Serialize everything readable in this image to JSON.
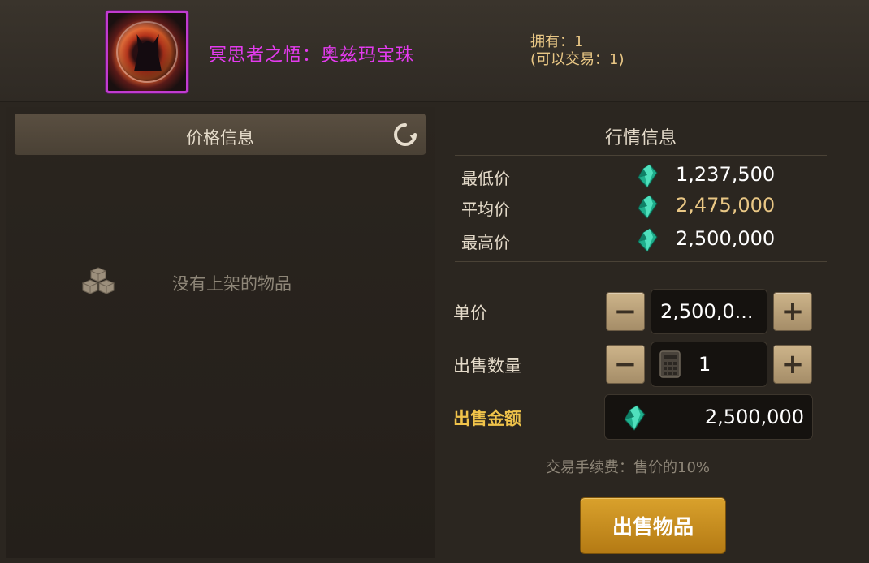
{
  "item": {
    "name": "冥思者之悟：奥兹玛宝珠",
    "name_color": "#e43bef",
    "icon": "ozma-orb-item-icon",
    "owned": "拥有：1",
    "tradable": "(可以交易：1)"
  },
  "price_panel": {
    "title": "价格信息",
    "refresh_icon": "refresh-icon",
    "empty_text": "没有上架的物品",
    "empty_icon": "boxes-icon"
  },
  "market": {
    "title": "行情信息",
    "currency_icon": "gem-icon",
    "rows": [
      {
        "label": "最低价",
        "value": "1,237,500"
      },
      {
        "label": "平均价",
        "value": "2,475,000"
      },
      {
        "label": "最高价",
        "value": "2,500,000"
      }
    ]
  },
  "sell_form": {
    "unit_price_label": "单价",
    "unit_price_value": "2,500,0...",
    "quantity_label": "出售数量",
    "quantity_value": "1",
    "total_label": "出售金额",
    "total_value": "2,500,000",
    "minus": "−",
    "plus": "+",
    "fee_text": "交易手续费：售价的10%",
    "sell_button": "出售物品"
  },
  "colors": {
    "accent_gold": "#f0c34a",
    "avg_price": "#e9c785",
    "button": "#c98f22"
  }
}
